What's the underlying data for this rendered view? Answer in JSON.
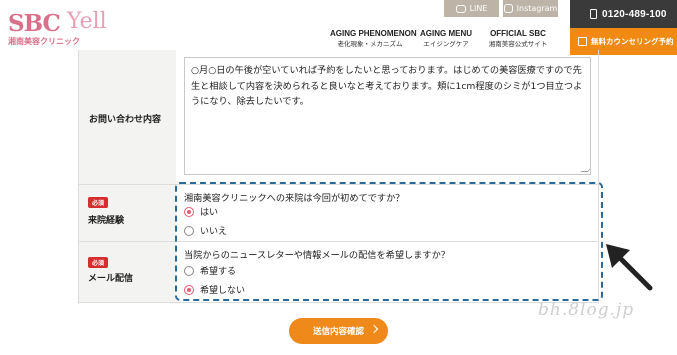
{
  "header": {
    "logo": {
      "brand": "SBC",
      "name": "Yell",
      "tagline": "湘南美容クリニック",
      "subline": "湘南美容クリニック"
    },
    "sns": {
      "line_label": "LINE",
      "instagram_label": "Instagram"
    },
    "nav": [
      {
        "en": "AGING PHENOMENON",
        "jp": "老化現象・メカニズム"
      },
      {
        "en": "AGING MENU",
        "jp": "エイジングケア"
      },
      {
        "en": "OFFICIAL SBC",
        "jp": "湘南美容公式サイト"
      }
    ],
    "phone": "0120-489-100",
    "reserve_label": "無料カウンセリング予約"
  },
  "form": {
    "inquiry": {
      "label": "お問い合わせ内容",
      "value": "○月○日の午後が空いていれば予約をしたいと思っております。はじめての美容医療ですので先生と相談して内容を決められると良いなと考えております。頬に1cm程度のシミが1つ目立つようになり、除去したいです。"
    },
    "visit": {
      "required": "必須",
      "label": "来院経験",
      "question": "湘南美容クリニックへの来院は今回が初めてですか？",
      "options": [
        {
          "label": "はい",
          "checked": true
        },
        {
          "label": "いいえ",
          "checked": false
        }
      ]
    },
    "newsletter": {
      "required": "必須",
      "label": "メール配信",
      "question": "当院からのニュースレターや情報メールの配信を希望しますか？",
      "options": [
        {
          "label": "希望する",
          "checked": false
        },
        {
          "label": "希望しない",
          "checked": true
        }
      ]
    },
    "submit_label": "送信内容確認"
  },
  "watermark": "bh.8log.jp",
  "colors": {
    "brand_pink": "#d9708a",
    "accent_orange": "#ef8a1a",
    "highlight_blue": "#2a6a9a",
    "required_red": "#d62e2e",
    "radio_pink": "#e25c74"
  }
}
